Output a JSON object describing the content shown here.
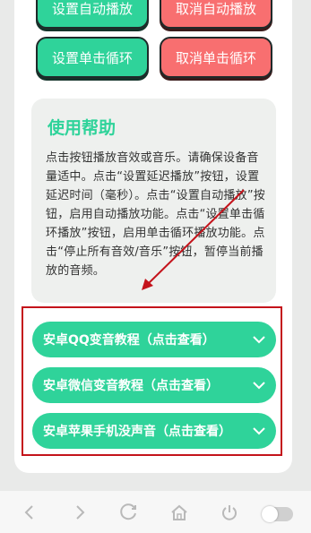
{
  "buttons": {
    "set_autoplay": "设置自动播放",
    "cancel_autoplay": "取消自动播放",
    "set_loop": "设置单击循环",
    "cancel_loop": "取消单击循环"
  },
  "help": {
    "title": "使用帮助",
    "text": "点击按钮播放音效或音乐。请确保设备音量适中。点击“设置延迟播放”按钮，设置延迟时间（毫秒）。点击“设置自动播放”按钮，启用自动播放功能。点击“设置单击循环播放”按钮，启用单击循环播放功能。点击“停止所有音效/音乐”按钮，暂停当前播放的音频。"
  },
  "tutorials": [
    {
      "label": "安卓QQ变音教程（点击查看）"
    },
    {
      "label": "安卓微信变音教程（点击查看）"
    },
    {
      "label": "安卓苹果手机没声音（点击查看）"
    }
  ],
  "icons": [
    "back-icon",
    "forward-icon",
    "reload-icon",
    "home-icon",
    "power-icon",
    "toggle-switch"
  ],
  "colors": {
    "accent_green": "#2fd39a",
    "accent_red": "#f86f70",
    "highlight_red": "#c4131b"
  }
}
